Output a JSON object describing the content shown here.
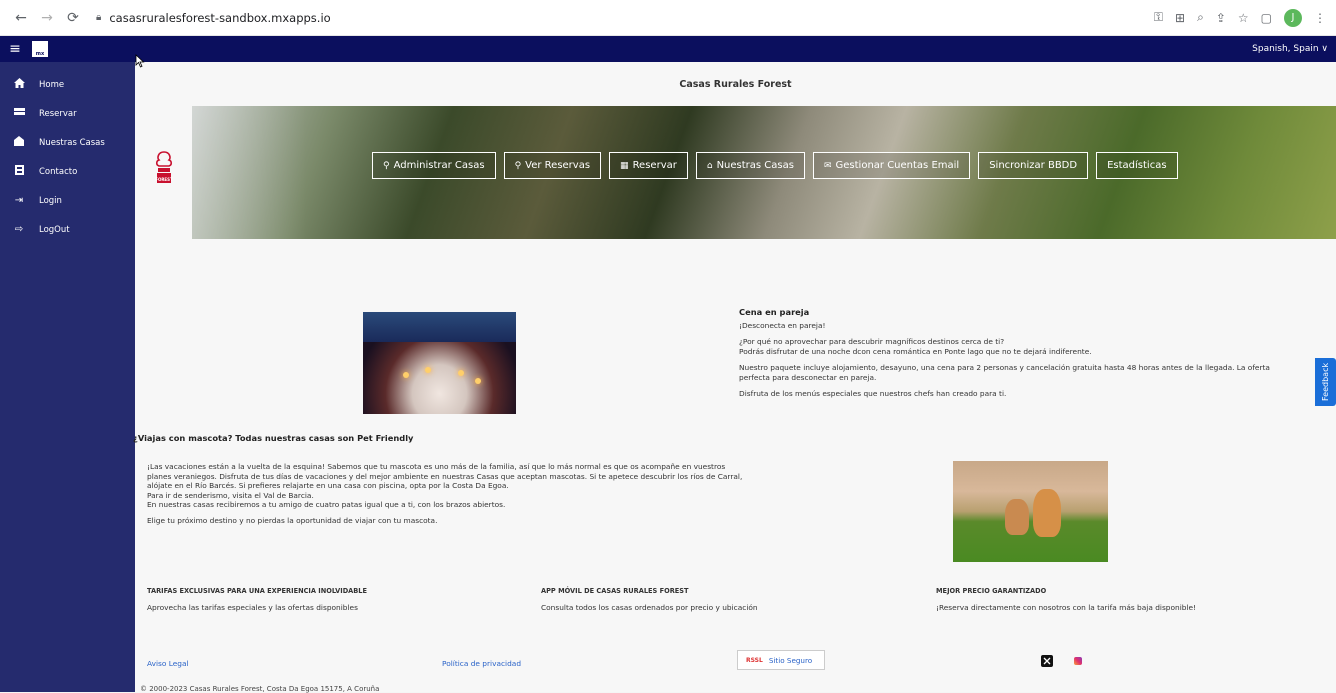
{
  "browser": {
    "url": "casasruralesforest-sandbox.mxapps.io",
    "profile_initial": "J"
  },
  "header": {
    "logo_text": "mx",
    "language": "Spanish, Spain ∨"
  },
  "sidebar": {
    "items": [
      {
        "label": "Home",
        "icon": "home-icon"
      },
      {
        "label": "Reservar",
        "icon": "bed-icon"
      },
      {
        "label": "Nuestras Casas",
        "icon": "house-icon"
      },
      {
        "label": "Contacto",
        "icon": "contact-card-icon"
      },
      {
        "label": "Login",
        "icon": "login-icon"
      },
      {
        "label": "LogOut",
        "icon": "logout-icon"
      }
    ]
  },
  "main": {
    "title": "Casas Rurales Forest",
    "crest_text": "FOREST",
    "banner_buttons": [
      {
        "label": "Administrar Casas",
        "icon": "⚲"
      },
      {
        "label": "Ver Reservas",
        "icon": "⚲"
      },
      {
        "label": "Reservar",
        "icon": "▦"
      },
      {
        "label": "Nuestras Casas",
        "icon": "⌂"
      },
      {
        "label": "Gestionar Cuentas Email",
        "icon": "✉"
      },
      {
        "label": "Sincronizar BBDD",
        "icon": ""
      },
      {
        "label": "Estadísticas",
        "icon": ""
      }
    ],
    "cena": {
      "title": "Cena en pareja",
      "p1": "¡Desconecta en pareja!",
      "p2a": "¿Por qué no aprovechar para descubrir magníficos destinos cerca de ti?",
      "p2b": "Podrás disfrutar de una noche dcon cena romántica en Ponte lago que no te dejará indiferente.",
      "p3": "Nuestro paquete incluye alojamiento, desayuno, una cena para 2 personas y cancelación gratuita hasta 48 horas antes de la llegada. La oferta perfecta para desconectar en pareja.",
      "p4": "Disfruta de los menús especiales que nuestros chefs han creado para ti."
    },
    "pet": {
      "title": "¿Viajas con mascota? Todas nuestras casas son Pet Friendly",
      "p1": "¡Las vacaciones están a la vuelta de la esquina! Sabemos que tu mascota es uno más de la familia, así que lo más normal es que os acompañe en vuestros planes veraniegos. Disfruta de tus días de vacaciones y del mejor ambiente en nuestras Casas que aceptan mascotas. Si te apetece descubrir los ríos de Carral, alójate en el Río Barcés. Si prefieres relajarte en una casa con piscina, opta por la Costa Da Egoa.",
      "p2": "Para ir de senderismo, visita el Val de Barcia.",
      "p3": "En nuestras casas recibiremos a tu amigo de cuatro patas igual que a ti, con los brazos abiertos.",
      "p4": "Elige tu próximo destino y no pierdas la oportunidad de viajar con tu mascota."
    },
    "features": [
      {
        "title": "TARIFAS EXCLUSIVAS PARA UNA EXPERIENCIA INOLVIDABLE",
        "text": "Aprovecha las tarifas especiales y las ofertas disponibles"
      },
      {
        "title": "APP MÓVIL DE CASAS RURALES FOREST",
        "text": "Consulta todos los casas ordenados por precio y ubicación"
      },
      {
        "title": "MEJOR PRECIO GARANTIZADO",
        "text": "¡Reserva directamente con nosotros con la tarifa más baja disponible!"
      }
    ],
    "footer": {
      "aviso": "Aviso Legal",
      "privacidad": "Política de privacidad",
      "secure_logo": "RSSL",
      "secure": "Sitio Seguro",
      "copyright": "© 2000-2023 Casas Rurales Forest, Costa Da Egoa 15175, A Coruña"
    },
    "feedback": "Feedback"
  },
  "colors": {
    "topbar": "#0b0f5e",
    "sidebar": "#252b6e",
    "link": "#2a63c8",
    "feedback": "#1a6ed8"
  }
}
